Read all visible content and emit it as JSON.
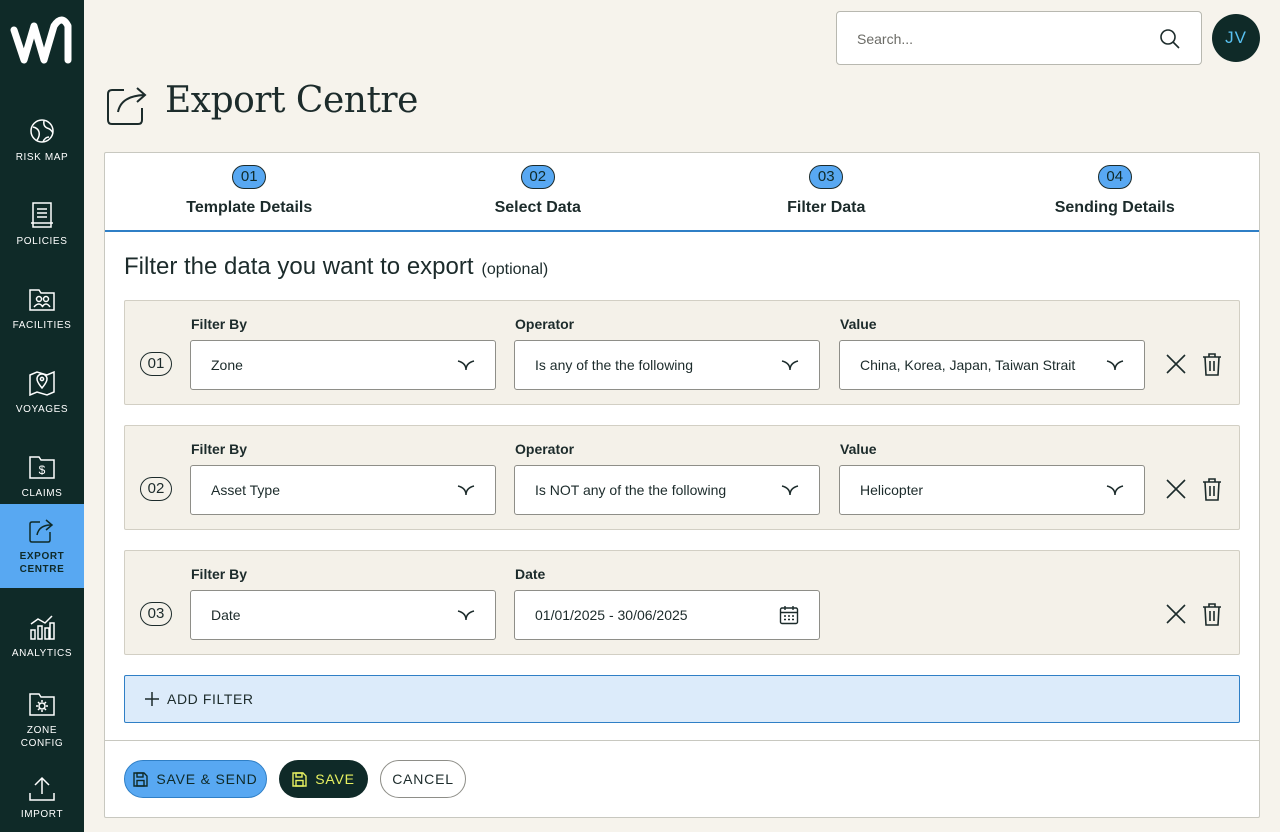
{
  "sidebar": {
    "logo_icon": "wave-w-logo",
    "items": [
      {
        "label": "RISK MAP",
        "icon": "globe-icon"
      },
      {
        "label": "POLICIES",
        "icon": "document-icon"
      },
      {
        "label": "FACILITIES",
        "icon": "folder-people-icon"
      },
      {
        "label": "VOYAGES",
        "icon": "map-pin-icon"
      },
      {
        "label": "CLAIMS",
        "icon": "dollar-doc-icon"
      },
      {
        "label": "EXPORT\nCENTRE",
        "icon": "export-icon",
        "active": true
      },
      {
        "label": "ANALYTICS",
        "icon": "chart-icon"
      },
      {
        "label": "ZONE\nCONFIG",
        "icon": "gear-icon"
      },
      {
        "label": "IMPORT",
        "icon": "upload-icon"
      }
    ]
  },
  "header": {
    "search_placeholder": "Search...",
    "avatar_initials": "JV"
  },
  "page": {
    "title": "Export Centre"
  },
  "steps": [
    {
      "num": "01",
      "label": "Template Details"
    },
    {
      "num": "02",
      "label": "Select Data"
    },
    {
      "num": "03",
      "label": "Filter Data"
    },
    {
      "num": "04",
      "label": "Sending Details"
    }
  ],
  "section": {
    "heading": "Filter the data you want to export",
    "optional": "(optional)"
  },
  "filters": [
    {
      "num": "01",
      "filter_by_label": "Filter By",
      "filter_by": "Zone",
      "operator_label": "Operator",
      "operator": "Is any of the the following",
      "value_label": "Value",
      "value": "China, Korea, Japan, Taiwan Strait"
    },
    {
      "num": "02",
      "filter_by_label": "Filter By",
      "filter_by": "Asset Type",
      "operator_label": "Operator",
      "operator": "Is NOT any of the the following",
      "value_label": "Value",
      "value": "Helicopter"
    },
    {
      "num": "03",
      "filter_by_label": "Filter By",
      "filter_by": "Date",
      "date_label": "Date",
      "date_value": "01/01/2025 - 30/06/2025"
    }
  ],
  "add_filter_label": "ADD FILTER",
  "footer": {
    "save_send_label": "SAVE & SEND",
    "save_label": "SAVE",
    "cancel_label": "CANCEL"
  },
  "colors": {
    "sidebar_bg": "#0f2a28",
    "accent_blue": "#58a8f2",
    "page_bg": "#f6f3ec",
    "filter_row_bg": "#f4f1e9",
    "save_text": "#e6f060"
  }
}
